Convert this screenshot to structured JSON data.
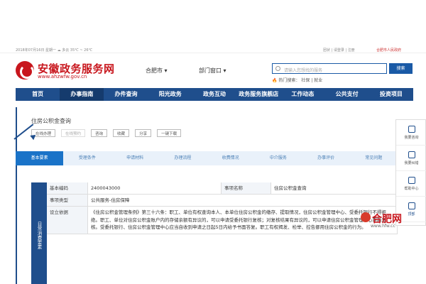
{
  "topbar": {
    "left": "2018年07月16日 星期一 ☁ 多云 35℃ ~ 26℃",
    "right": "团状 | 请登录 | 注册",
    "gov": "合肥市人民政府"
  },
  "brand": {
    "name": "安徽政务服务网",
    "url": "www.ahzwfw.gov.cn"
  },
  "header": {
    "city": "合肥市 ▾",
    "window": "部门窗口 ▾",
    "search_placeholder": "请输入您想找的服务",
    "search_btn": "搜索",
    "hot": "🔥 热门搜索： 社保 | 就业"
  },
  "nav": {
    "items": [
      "首页",
      "办事指南",
      "办件查询",
      "阳光政务",
      "政务互动",
      "政务服务旗舰店",
      "工作动态",
      "公共支付",
      "投资项目"
    ],
    "active_index": 1
  },
  "panel": {
    "title": "住房公积金查询",
    "actions": [
      "在线办理",
      "在线预约",
      "咨询",
      "收藏",
      "分享",
      "一键下载"
    ],
    "disabled_action": "在线预约"
  },
  "tabs": {
    "items": [
      "基本要素",
      "受理条件",
      "申请材料",
      "办理流程",
      "收费情况",
      "中介服务",
      "办事评价",
      "常见问题"
    ],
    "active_index": 0
  },
  "sidecol": "日常消费要素",
  "table": {
    "rows": [
      [
        "基本编码",
        "2400043000",
        "事项名称",
        "住房公积金查询"
      ],
      [
        "事项类型",
        "公共服务-住房保障",
        "",
        ""
      ],
      [
        "设立依据",
        "《住房公积金管理条例》第三十六条：职工、单位有权查询本人、本单位住房公积金的缴存、提取情况，住房公积金管理中心、受委托银行不得拒绝。职工、单位对住房公积金账户内的存储余额有异议的，可以申请受委托银行复核；对复核结果有异议的，可以申请住房公积金管理中心重新复核。受委托银行、住房公积金管理中心应当自收到申请之日起5日内给予书面答复。职工有权揭发、检举、控告挪用住房公积金的行为。",
        "",
        ""
      ]
    ]
  },
  "float": [
    "我要咨询",
    "我要纠错",
    "帮助中心",
    "顶部"
  ],
  "watermark": {
    "title": "合肥网",
    "url": "www.hfw.cc"
  }
}
